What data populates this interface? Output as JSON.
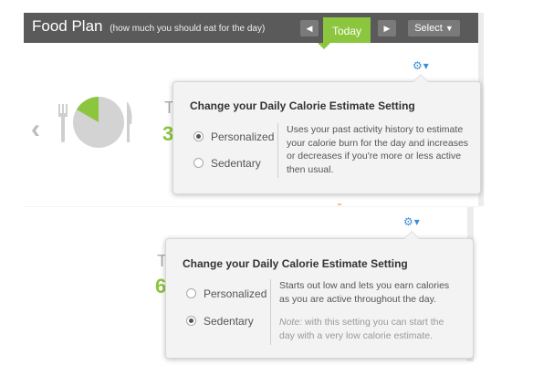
{
  "header": {
    "title": "Food Plan",
    "subtitle": "(how much you should eat for the day)",
    "prev_icon": "◀",
    "today_label": "Today",
    "next_icon": "▶",
    "select_label": "Select",
    "select_caret": "▼"
  },
  "background": {
    "nav_arrow": "‹",
    "top_letter": "T",
    "top_digit": "3",
    "bottom_letter": "T",
    "bottom_digit": "6"
  },
  "settings_trigger": {
    "gear": "⚙",
    "caret": "▾"
  },
  "popup_personalized": {
    "title": "Change your Daily Calorie Estimate Setting",
    "options": [
      {
        "label": "Personalized",
        "selected": true
      },
      {
        "label": "Sedentary",
        "selected": false
      }
    ],
    "description": "Uses your past activity history to estimate your calorie burn for the day and increases or decreases if you're more or less active then usual."
  },
  "popup_sedentary": {
    "title": "Change your Daily Calorie Estimate Setting",
    "options": [
      {
        "label": "Personalized",
        "selected": false
      },
      {
        "label": "Sedentary",
        "selected": true
      }
    ],
    "description": "Starts out low and lets you earn calories as you are active throughout the day.",
    "note_label": "Note:",
    "note_text": " with this setting you can start the day with a very low calorie estimate."
  },
  "colors": {
    "header_bg": "#5a5a5a",
    "accent_green": "#8cc63f",
    "gear_blue": "#3b8fd9"
  }
}
